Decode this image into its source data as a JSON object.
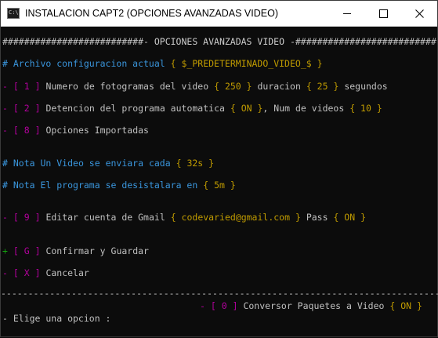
{
  "window": {
    "icon_text": "C:\\.",
    "title": "INSTALACION CAPT2 (OPCIONES AVANZADAS VIDEO)"
  },
  "console": {
    "header": {
      "left": "##########################-",
      "title": " OPCIONES AVANZADAS VIDEO ",
      "right": "-##########################"
    },
    "config": {
      "prefix": "# Archivo configuracion actual",
      "value": "{ $_PREDETERMINADO_VIDEO_$ }"
    },
    "options": [
      {
        "bullet": "-",
        "key": "[ 1 ]",
        "text1": "Numero de fotogramas del video",
        "val1": "{ 250 }",
        "text2": "duracion",
        "val2": "{ 25 }",
        "text3": "segundos"
      },
      {
        "bullet": "-",
        "key": "[ 2 ]",
        "text1": "Detencion del programa automatica",
        "val1": "{ ON }",
        "text2": ", Num de videos",
        "val2": "{ 10 }"
      },
      {
        "bullet": "-",
        "key": "[ 8 ]",
        "text1": "Opciones Importadas"
      }
    ],
    "notes": [
      {
        "label": "# Nota",
        "text": "Un Video se enviara cada",
        "value": "{ 32s }"
      },
      {
        "label": "# Nota",
        "text": "El programa se desistalara en",
        "value": "{ 5m }"
      }
    ],
    "gmail": {
      "bullet": "-",
      "key": "[ 9 ]",
      "text1": "Editar cuenta de Gmail",
      "email": "{ codevaried@gmail.com }",
      "text2": "Pass",
      "pass": "{ ON }"
    },
    "confirm": {
      "bullet": "+",
      "key": "[ G ]",
      "text": "Confirmar y Guardar"
    },
    "cancel": {
      "bullet": "-",
      "key": "[ X ]",
      "text": "Cancelar"
    },
    "divider": "-----------------------------------------------------------------------------------",
    "converter": {
      "bullet": "-",
      "key": "[ 0 ]",
      "text": "Conversor Paquetes a Video",
      "value": "{ ON }"
    },
    "prompt": "- Elige una opcion :"
  },
  "colors": {
    "background": "#0c0c0c",
    "text": "#c0c0c0",
    "magenta": "#b4009e",
    "yellow": "#c19c00",
    "cyan": "#3a96dd",
    "green": "#13a10e"
  }
}
